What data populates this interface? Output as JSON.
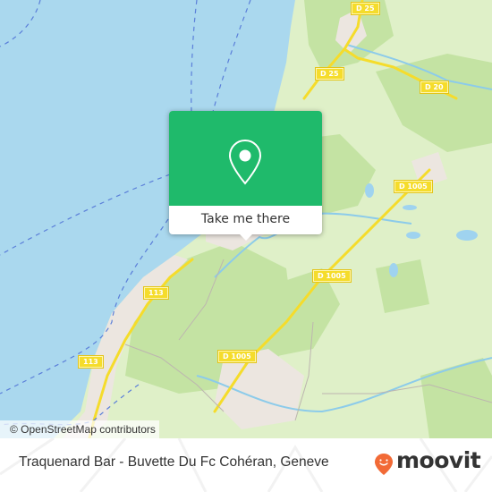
{
  "map": {
    "colors": {
      "water": "#aad8ee",
      "land": "#dff0c8",
      "forest": "#c4e3a3",
      "urban": "#ece6e0",
      "road": "#f5dc2b",
      "river": "#9fd3ef",
      "ferry_route": "#5b7fd9"
    },
    "road_labels": [
      {
        "id": "d25-top",
        "text": "D 25"
      },
      {
        "id": "d25-mid",
        "text": "D 25"
      },
      {
        "id": "d20",
        "text": "D 20"
      },
      {
        "id": "d1005-upper",
        "text": "D 1005"
      },
      {
        "id": "d1005-mid",
        "text": "D 1005"
      },
      {
        "id": "d1005-lower",
        "text": "D 1005"
      },
      {
        "id": "113-upper",
        "text": "113"
      },
      {
        "id": "113-lower",
        "text": "113"
      }
    ],
    "attribution": "© OpenStreetMap contributors"
  },
  "popup": {
    "accent_color": "#1fba6b",
    "icon": "map-pin-icon",
    "cta_label": "Take me there"
  },
  "footer": {
    "place_name": "Traquenard Bar - Buvette Du Fc Cohéran, Geneve",
    "brand": {
      "name": "moovit",
      "logo_icon": "moovit-smiley-pin-icon",
      "color": "#f26a36"
    }
  }
}
